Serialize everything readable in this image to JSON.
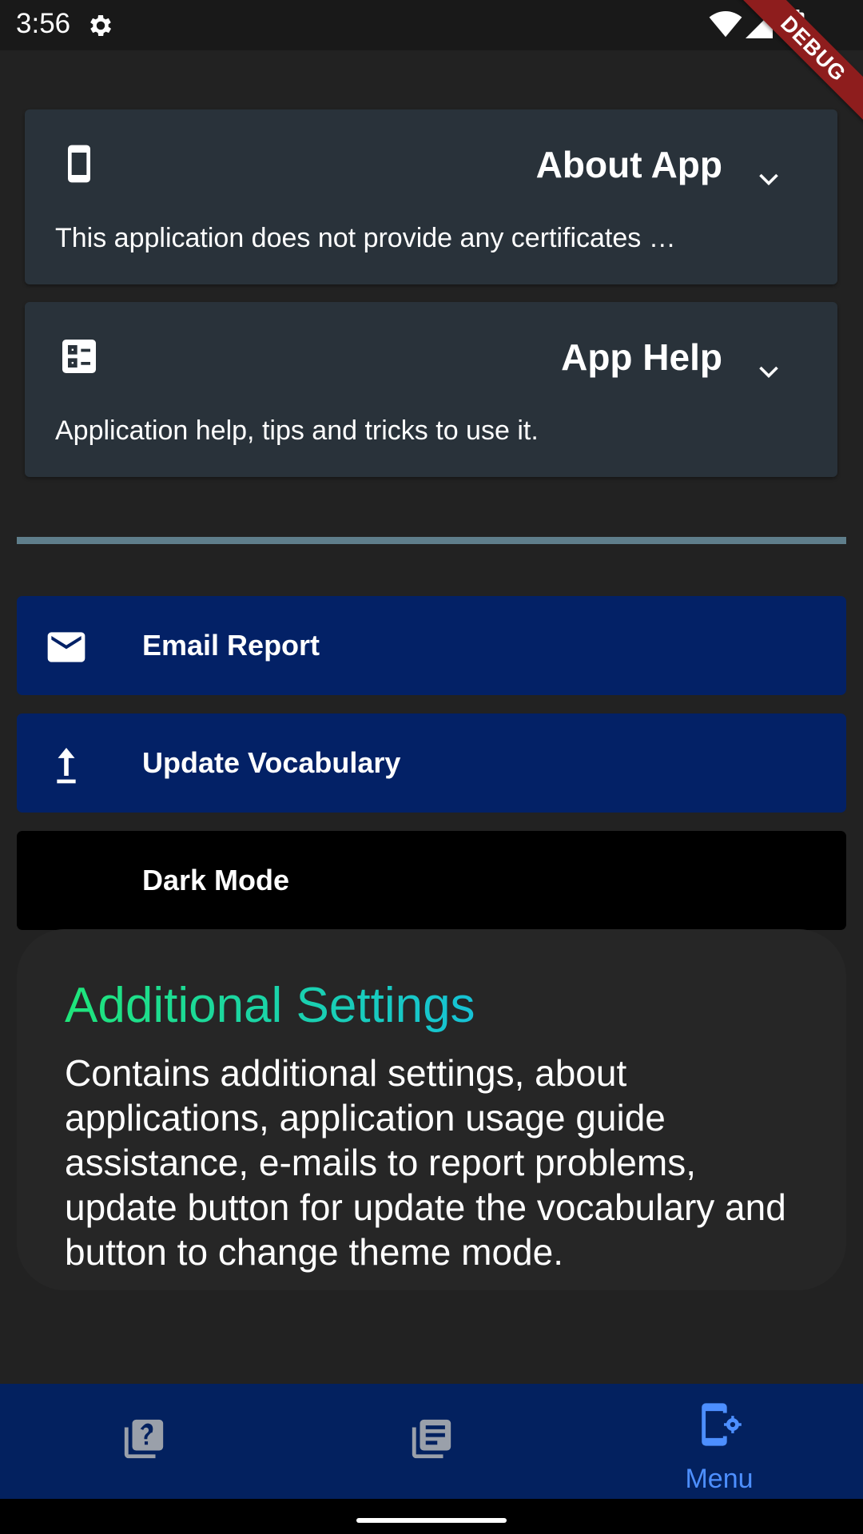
{
  "status_bar": {
    "time": "3:56",
    "debug_banner": "DEBUG"
  },
  "cards": [
    {
      "title": "About App",
      "description": "This application does not provide any certificates …",
      "icon": "smartphone-icon"
    },
    {
      "title": "App Help",
      "description": "Application help, tips and tricks to use it.",
      "icon": "help-list-icon"
    }
  ],
  "actions": [
    {
      "label": "Email Report",
      "icon": "mail-icon",
      "bg": "#032166"
    },
    {
      "label": "Update Vocabulary",
      "icon": "upload-icon",
      "bg": "#032166"
    },
    {
      "label": "Dark Mode",
      "icon": "moon-icon",
      "bg": "#000000"
    }
  ],
  "info": {
    "title": "Additional Settings",
    "body": "Contains additional settings, about applications, application usage guide assistance, e-mails to report problems, update button for update the vocabulary and button to change theme mode."
  },
  "bottom_nav": {
    "items": [
      {
        "icon": "quiz-icon",
        "label": ""
      },
      {
        "icon": "library-books-icon",
        "label": ""
      },
      {
        "icon": "settings-phone-icon",
        "label": "Menu",
        "active": true
      }
    ]
  },
  "colors": {
    "background": "#222222",
    "card": "#29323a",
    "divider": "#5f7e8b",
    "button_blue": "#032166",
    "nav_active": "#4d8fff",
    "title_gradient_start": "#1fe57a",
    "title_gradient_end": "#16c2d6"
  }
}
